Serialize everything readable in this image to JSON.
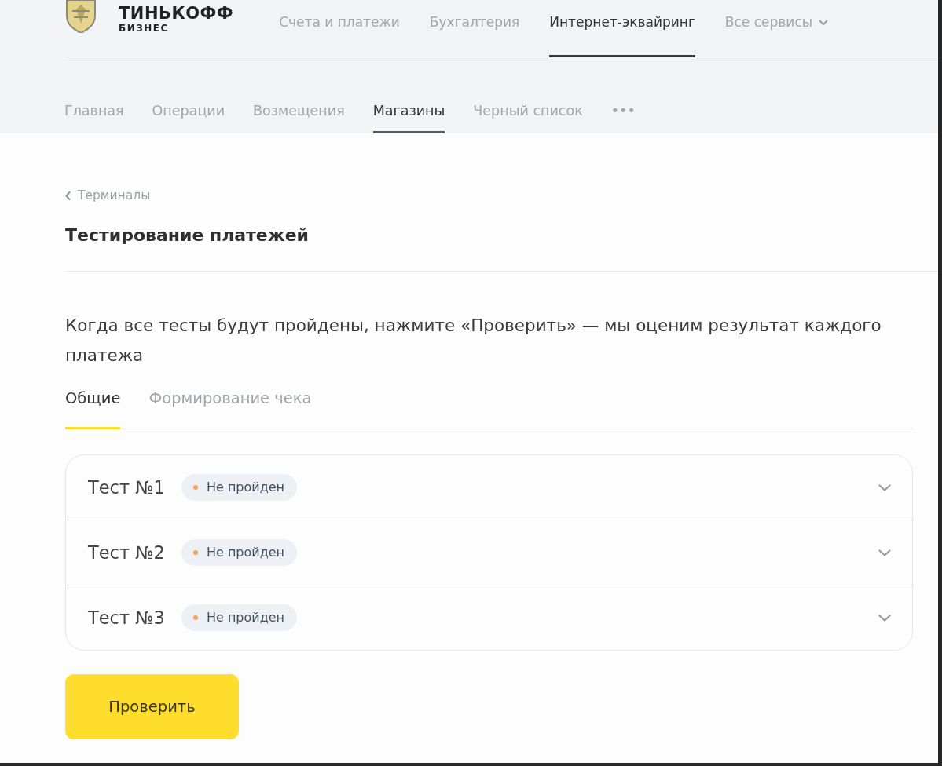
{
  "brand": {
    "name": "ТИНЬКОФФ",
    "subtitle": "БИЗНЕС"
  },
  "top_nav": [
    {
      "label": "Счета и платежи",
      "selected": false,
      "kind": "link"
    },
    {
      "label": "Бухгалтерия",
      "selected": false,
      "kind": "link"
    },
    {
      "label": "Интернет-эквайринг",
      "selected": true,
      "kind": "link"
    },
    {
      "label": "Все сервисы",
      "selected": false,
      "kind": "dropdown"
    }
  ],
  "sub_nav": [
    {
      "label": "Главная",
      "selected": false
    },
    {
      "label": "Операции",
      "selected": false
    },
    {
      "label": "Возмещения",
      "selected": false
    },
    {
      "label": "Магазины",
      "selected": true
    },
    {
      "label": "Черный список",
      "selected": false
    },
    {
      "label": "•••",
      "selected": false
    }
  ],
  "breadcrumb": {
    "label": "Терминалы"
  },
  "title": "Тестирование платежей",
  "description": "Когда все тесты будут пройдены, нажмите «Проверить» — мы оценим результат каждого платежа",
  "tabs": [
    {
      "label": "Общие",
      "selected": true
    },
    {
      "label": "Формирование чека",
      "selected": false
    }
  ],
  "tests": [
    {
      "name": "Тест №1",
      "status": "Не пройден",
      "expanded": false
    },
    {
      "name": "Тест №2",
      "status": "Не пройден",
      "expanded": false
    },
    {
      "name": "Тест №3",
      "status": "Не пройден",
      "expanded": false
    }
  ],
  "primary_button": "Проверить"
}
